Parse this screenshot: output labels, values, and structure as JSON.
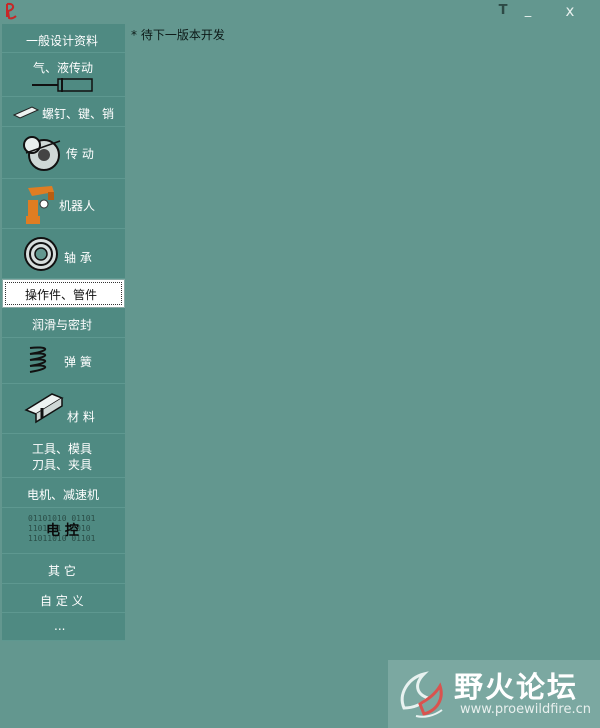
{
  "titlebar": {
    "t_label": "T",
    "minimize_label": "_",
    "close_label": "x"
  },
  "sidebar": {
    "items": [
      {
        "label": "一般设计资料"
      },
      {
        "label": "气、液传动"
      },
      {
        "label": "螺钉、键、销"
      },
      {
        "label": "传 动"
      },
      {
        "label": "机器人"
      },
      {
        "label": "轴 承"
      },
      {
        "label": "操作件、管件"
      },
      {
        "label": "润滑与密封"
      },
      {
        "label": "弹 簧"
      },
      {
        "label": "材 料"
      },
      {
        "label_line1": "工具、模具",
        "label_line2": "刀具、夹具"
      },
      {
        "label": "电机、减速机"
      },
      {
        "label": "电 控",
        "binary_rows": [
          "01101010 01101",
          "1101 01 01010",
          "11011010 01101"
        ]
      },
      {
        "label": "其 它"
      },
      {
        "label": "自 定 义"
      },
      {
        "label": "..."
      }
    ],
    "selected_index": 6
  },
  "main": {
    "note": "* 待下一版本开发"
  },
  "watermark": {
    "title": "野火论坛",
    "url": "www.proewildfire.cn"
  },
  "colors": {
    "background": "#63978f",
    "sidebar_item": "#4f8a82",
    "robot_orange": "#e07d22"
  }
}
